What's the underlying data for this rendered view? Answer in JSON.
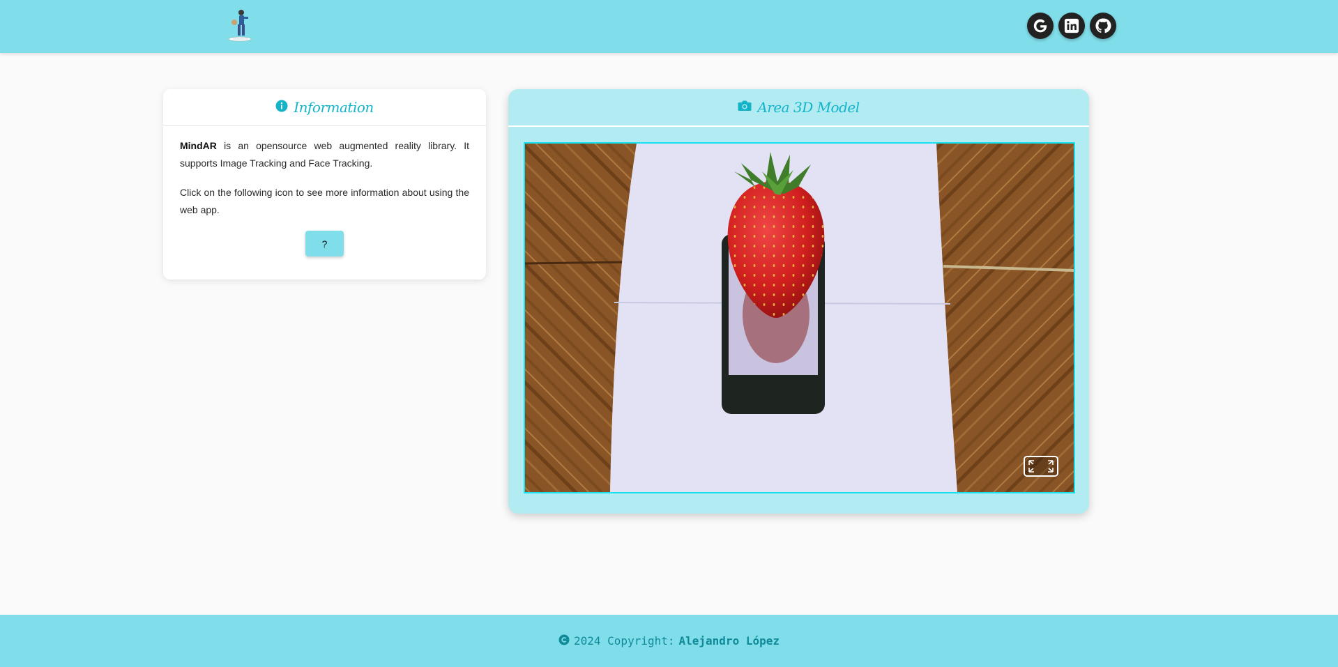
{
  "header": {
    "logo_icon": "skater-logo-icon",
    "social": [
      {
        "name": "google",
        "icon": "google-icon"
      },
      {
        "name": "linkedin",
        "icon": "linkedin-icon"
      },
      {
        "name": "github",
        "icon": "github-icon"
      }
    ]
  },
  "info_card": {
    "title": "Information",
    "title_icon": "info-circle-icon",
    "brand": "MindAR",
    "paragraph1_rest": " is an opensource web augmented reality library. It supports Image Tracking and Face Tracking.",
    "paragraph2": "Click on the following icon to see more information about using the web app.",
    "help_button_label": "?"
  },
  "area_card": {
    "title": "Area 3D Model",
    "title_icon": "camera-icon",
    "viewport_content": "strawberry-3d-model-on-phone",
    "fullscreen_icon": "fullscreen-icon"
  },
  "footer": {
    "copyright_icon": "copyright-icon",
    "text": "2024 Copyright:",
    "author": "Alejandro López"
  },
  "colors": {
    "header_bg": "#80deea",
    "accent_text": "#14b4c8",
    "area_bg": "#b2ebf2",
    "viewport_border": "#18e0f0",
    "footer_text": "#0f8a99"
  }
}
